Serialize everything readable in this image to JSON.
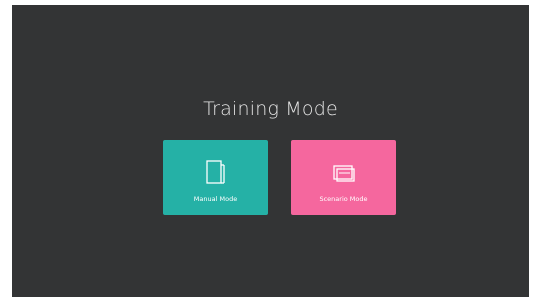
{
  "screen": {
    "title": "Training Mode",
    "background": "#333435"
  },
  "modes": [
    {
      "label": "Manual Mode",
      "icon": "document-icon",
      "color": "#25b1a6"
    },
    {
      "label": "Scenario Mode",
      "icon": "stacked-screens-icon",
      "color": "#f5679e"
    }
  ]
}
